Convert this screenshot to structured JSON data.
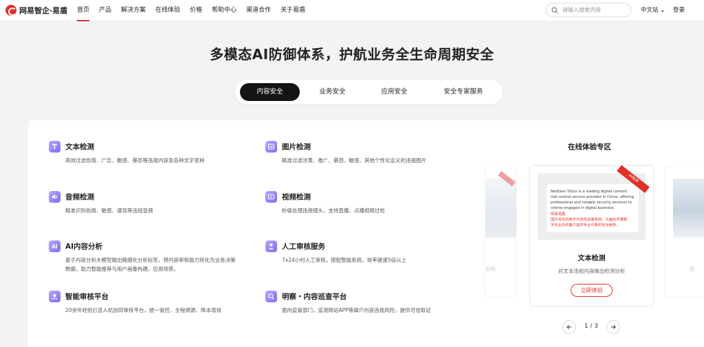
{
  "brand": {
    "name": "网易智企·易盾",
    "color": "#e0312a"
  },
  "nav": {
    "items": [
      "首页",
      "产品",
      "解决方案",
      "在线体验",
      "价格",
      "帮助中心",
      "渠道合作",
      "关于易盾"
    ],
    "active_index": 0
  },
  "search": {
    "placeholder": "请输入搜索内容",
    "icon": "search-icon"
  },
  "lang": {
    "label": "中文站",
    "icon": "chevron-down-icon"
  },
  "login": "登录",
  "hero": {
    "title": "多模态AI防御体系，护航业务全生命周期安全"
  },
  "tabs": [
    {
      "label": "内容安全",
      "active": true
    },
    {
      "label": "业务安全",
      "active": false
    },
    {
      "label": "应用安全",
      "active": false
    },
    {
      "label": "安全专家服务",
      "active": false
    }
  ],
  "features": [
    {
      "title": "文本检测",
      "desc": "高效过滤色情、广告、敏感、暴恐等违规内容及各种文字变种",
      "icon": "text-icon"
    },
    {
      "title": "图片检测",
      "desc": "精准过滤涉黄、推广、暴恐、敏感、其他个性化定义的违规图片",
      "icon": "image-icon"
    },
    {
      "title": "音频检测",
      "desc": "精准识别色情、敏感、谩骂等违规音频",
      "icon": "audio-icon"
    },
    {
      "title": "视频检测",
      "desc": "秒级处理违规镜头，支持直播、点播视频过检",
      "icon": "video-icon"
    },
    {
      "title": "AI内容分析",
      "desc_line1": "基于内容分析大模型输出精细化分析标签，将内容审核能力转化为业务决策",
      "desc_line2": "数据，助力智能推荐与用户画像构建。应用场景。",
      "icon": "ai-icon"
    },
    {
      "title": "人工审核服务",
      "desc": "7x24小时人工审核，搭配智能系统，效率提速5倍以上",
      "icon": "person-icon"
    },
    {
      "title": "智能审核平台",
      "desc": "20余年经验打造人机协同审核平台，统一管控、全程溯源、降本增效",
      "icon": "platform-icon"
    },
    {
      "title": "明察・内容巡查平台",
      "desc": "面向监管部门，监测网站APP等媒介内容违规风险，提供可信取证",
      "icon": "inspect-icon"
    }
  ],
  "online": {
    "title": "在线体验专区",
    "card": {
      "ribbon": "AI检测",
      "sample_en": "NetEase YiDun is a leading digital content\nrisk control service provider in China, offering\nprofessional and reliable security services to\nclients engaged in digital business.",
      "sample_zh": "网易易盾\n国内领先的数字内容风控服务商。为面向开展数\n字化业务的客户提供专业可靠的安全服务。",
      "title": "文本检测",
      "desc": "对文本违规内容做出检测分析",
      "button": "立即体验"
    },
    "side_left": {
      "text": "分析",
      "ribbon": "AI检测"
    },
    "side_right": {
      "text": "对"
    },
    "pager": {
      "text": "1 / 3"
    }
  }
}
